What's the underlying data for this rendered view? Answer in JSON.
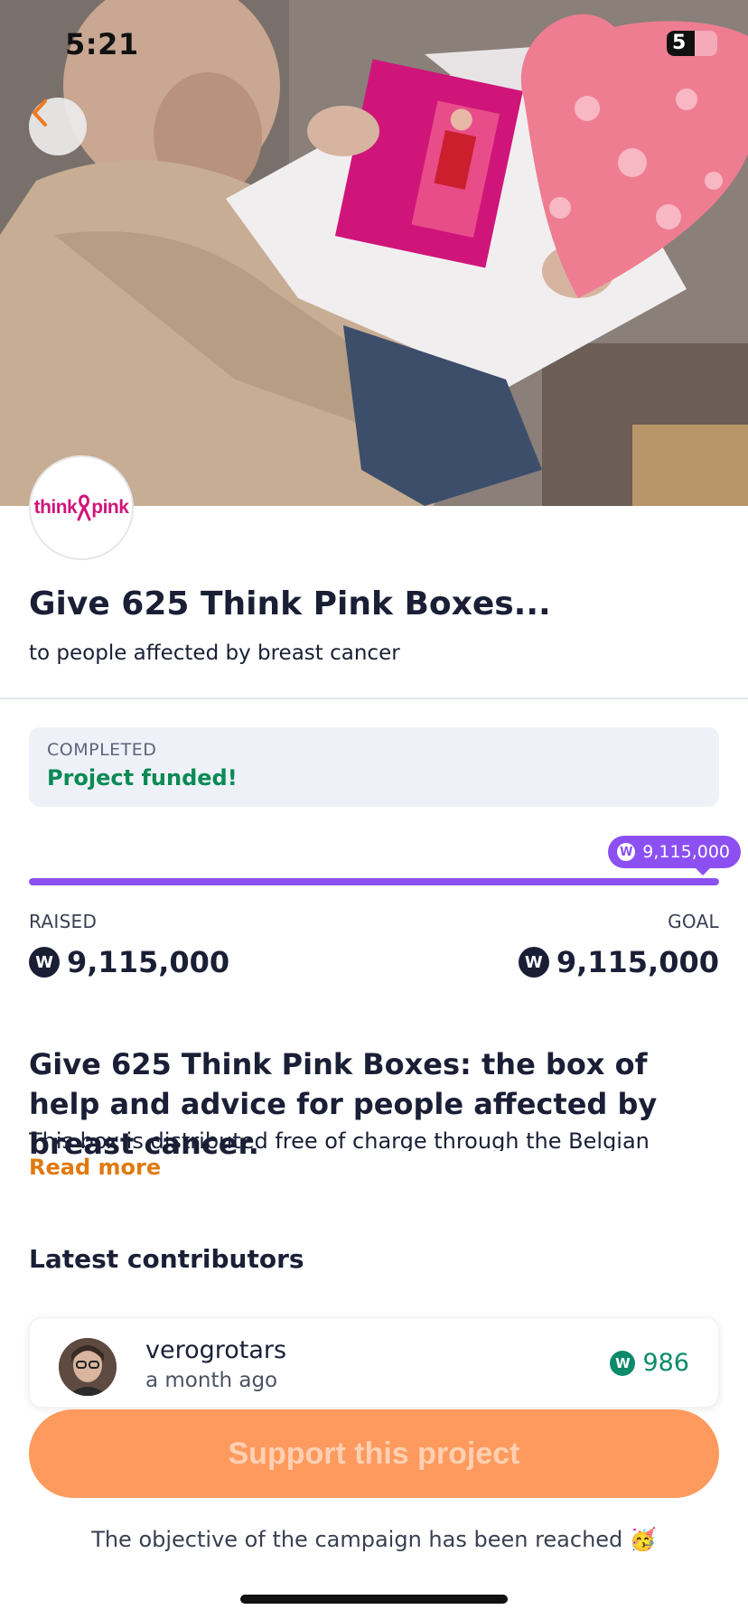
{
  "status_bar": {
    "time": "5:21",
    "battery": "5"
  },
  "hero": {
    "image_alt": "Person holding Think Pink box and heart-shaped cushion"
  },
  "org": {
    "logo_text_left": "think",
    "logo_text_right": "pink",
    "brand_color": "#d0157a"
  },
  "project": {
    "title": "Give 625 Think Pink Boxes...",
    "subtitle": "to people affected by breast cancer",
    "status_label": "COMPLETED",
    "status_value": "Project funded!"
  },
  "funding": {
    "badge_amount": "9,115,000",
    "raised_label": "RAISED",
    "goal_label": "GOAL",
    "raised_amount": "9,115,000",
    "goal_amount": "9,115,000",
    "progress_percent": 100,
    "coin_symbol": "W",
    "accent_color": "#8b4ff2"
  },
  "description": {
    "heading": "Give 625 Think Pink Boxes: the box of help and advice for people affected by breast cancer.",
    "body": "This box is distributed free of charge through the Belgian",
    "read_more": "Read more"
  },
  "contributors": {
    "heading": "Latest contributors",
    "items": [
      {
        "name": "verogrotars",
        "time": "a month ago",
        "amount": "986"
      }
    ]
  },
  "cta": {
    "label": "Support this project",
    "color": "#ff9a5e"
  },
  "footer": {
    "note": "The objective of the campaign has been reached 🥳"
  }
}
